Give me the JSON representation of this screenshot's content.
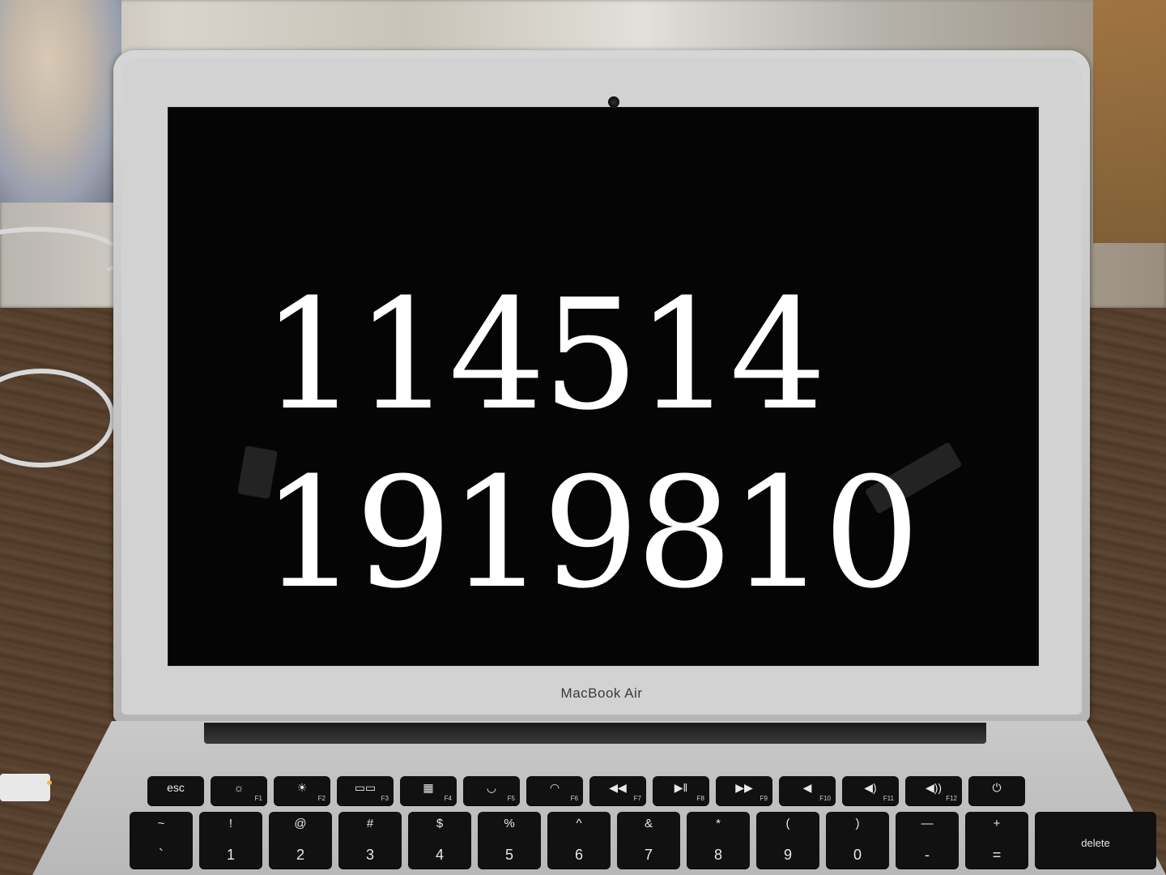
{
  "screen": {
    "line1": "114514",
    "line2": "1919810"
  },
  "laptop": {
    "brand": "MacBook Air"
  },
  "function_row": [
    {
      "glyph": "esc",
      "sub": ""
    },
    {
      "glyph": "☼",
      "sub": "F1"
    },
    {
      "glyph": "☀",
      "sub": "F2"
    },
    {
      "glyph": "▭▭",
      "sub": "F3"
    },
    {
      "glyph": "▦",
      "sub": "F4"
    },
    {
      "glyph": "◡",
      "sub": "F5"
    },
    {
      "glyph": "◠",
      "sub": "F6"
    },
    {
      "glyph": "◀◀",
      "sub": "F7"
    },
    {
      "glyph": "▶ǁ",
      "sub": "F8"
    },
    {
      "glyph": "▶▶",
      "sub": "F9"
    },
    {
      "glyph": "◀",
      "sub": "F10"
    },
    {
      "glyph": "◀)",
      "sub": "F11"
    },
    {
      "glyph": "◀))",
      "sub": "F12"
    },
    {
      "glyph": "⏻",
      "sub": ""
    }
  ],
  "number_row": [
    {
      "sym": "~",
      "dig": "`"
    },
    {
      "sym": "!",
      "dig": "1"
    },
    {
      "sym": "@",
      "dig": "2"
    },
    {
      "sym": "#",
      "dig": "3"
    },
    {
      "sym": "$",
      "dig": "4"
    },
    {
      "sym": "%",
      "dig": "5"
    },
    {
      "sym": "^",
      "dig": "6"
    },
    {
      "sym": "&",
      "dig": "7"
    },
    {
      "sym": "*",
      "dig": "8"
    },
    {
      "sym": "(",
      "dig": "9"
    },
    {
      "sym": ")",
      "dig": "0"
    },
    {
      "sym": "—",
      "dig": "-"
    },
    {
      "sym": "+",
      "dig": "="
    },
    {
      "sym": "",
      "dig": "delete"
    }
  ]
}
